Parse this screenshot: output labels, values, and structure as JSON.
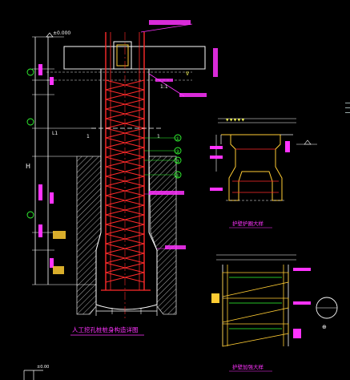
{
  "drawing": {
    "main_title": "人工挖孔桩桩身构造详图",
    "detail_retaining_ring": "护壁护圈大样",
    "detail_casing": "护壁加强大样",
    "elevation_top": "±0.000",
    "dim_left_total": "H",
    "dim_segment_mid": "L1",
    "markers": [
      "①",
      "②",
      "③",
      "①"
    ],
    "ring_mark": "⊕",
    "bottom_stamp": "±0.00"
  },
  "colors": {
    "background": "#000000",
    "rebar": "#ff2a2a",
    "annotation": "#ff33ff",
    "dimension": "#ffffff",
    "marker": "#33ff33",
    "soil": "#c8c8c8",
    "concrete": "#ffcc33",
    "text_yellow": "#ffff55"
  }
}
